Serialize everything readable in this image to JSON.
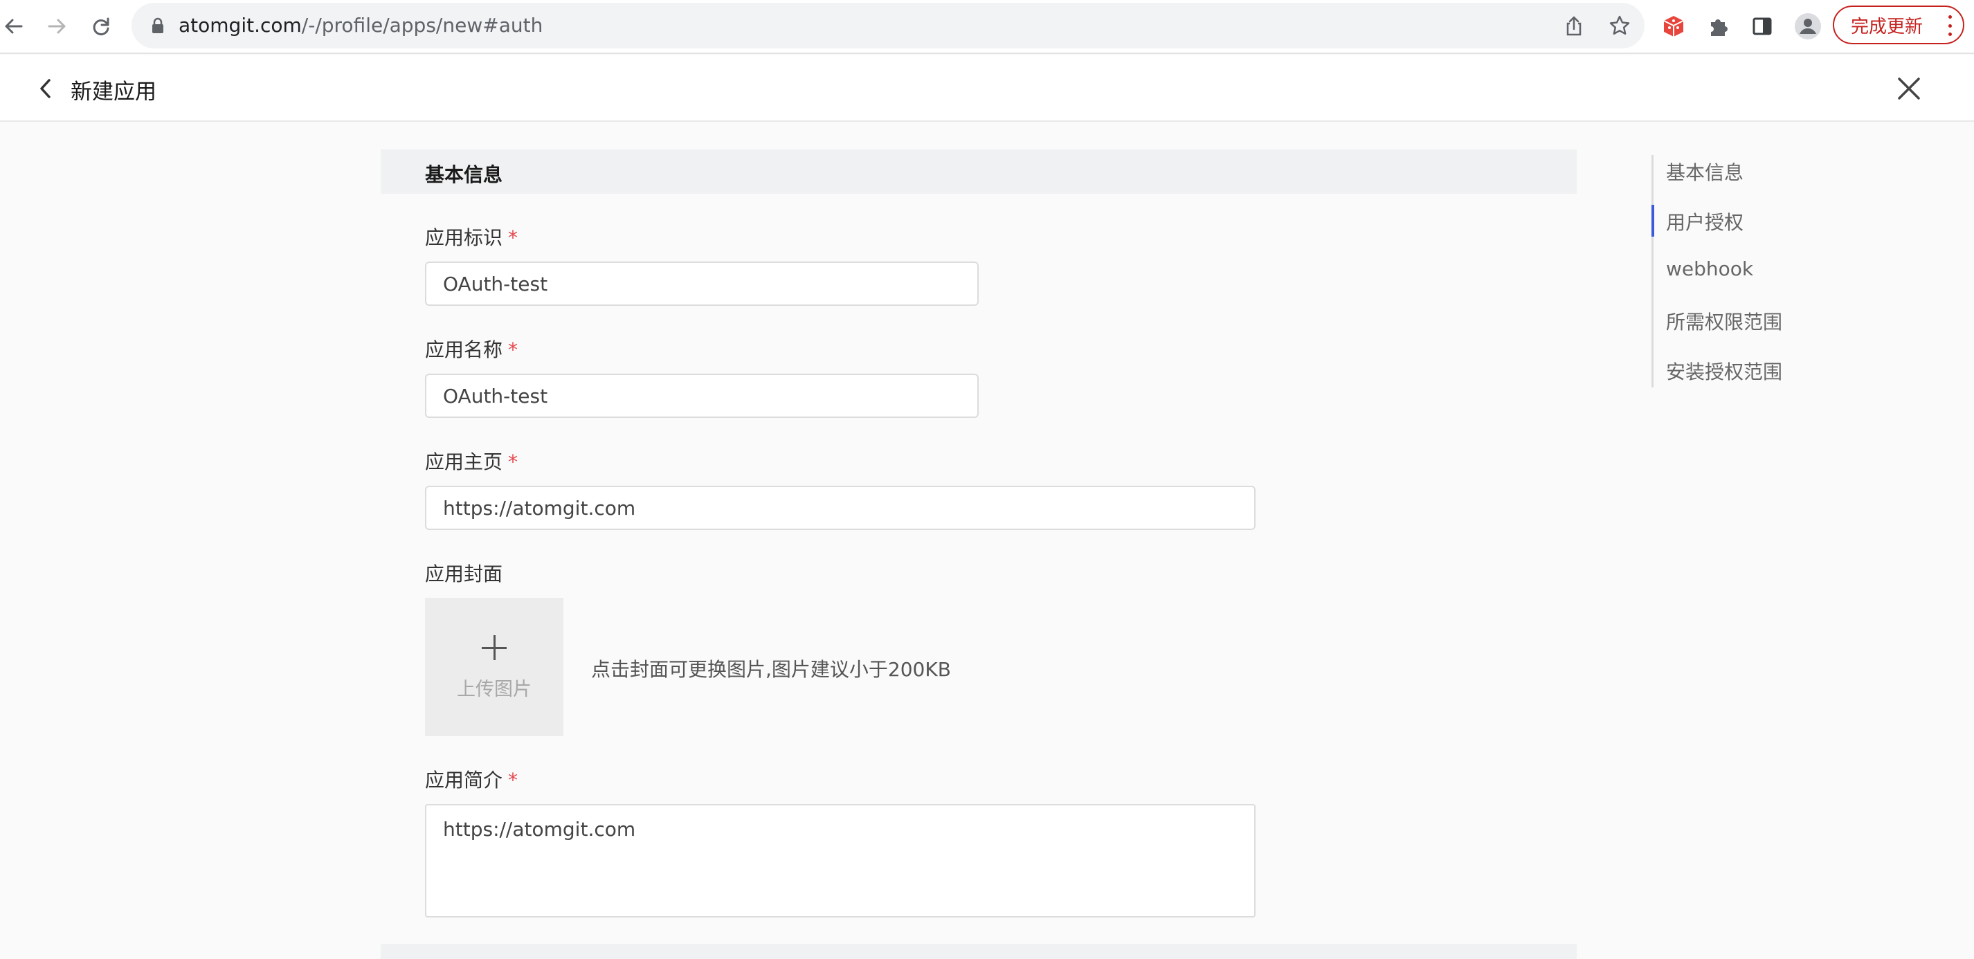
{
  "browser": {
    "url_host": "atomgit.com",
    "url_path": "/-/profile/apps/new#auth",
    "update_label": "完成更新"
  },
  "header": {
    "title": "新建应用"
  },
  "form": {
    "section_title": "基本信息",
    "fields": {
      "app_id": {
        "label": "应用标识",
        "required_mark": "*",
        "value": "OAuth-test"
      },
      "app_name": {
        "label": "应用名称",
        "required_mark": "*",
        "value": "OAuth-test"
      },
      "homepage": {
        "label": "应用主页",
        "required_mark": "*",
        "value": "https://atomgit.com"
      },
      "cover": {
        "label": "应用封面",
        "upload_label": "上传图片",
        "hint": "点击封面可更换图片,图片建议小于200KB"
      },
      "description": {
        "label": "应用简介",
        "required_mark": "*",
        "value": "https://atomgit.com"
      }
    }
  },
  "anchor_nav": {
    "items": [
      {
        "label": "基本信息"
      },
      {
        "label": "用户授权"
      },
      {
        "label": "webhook"
      },
      {
        "label": "所需权限范围"
      },
      {
        "label": "安装授权范围"
      }
    ],
    "active_index": 1
  },
  "colors": {
    "required": "#e5484d",
    "accent": "#3b5bdb",
    "update_button": "#c5221f"
  }
}
